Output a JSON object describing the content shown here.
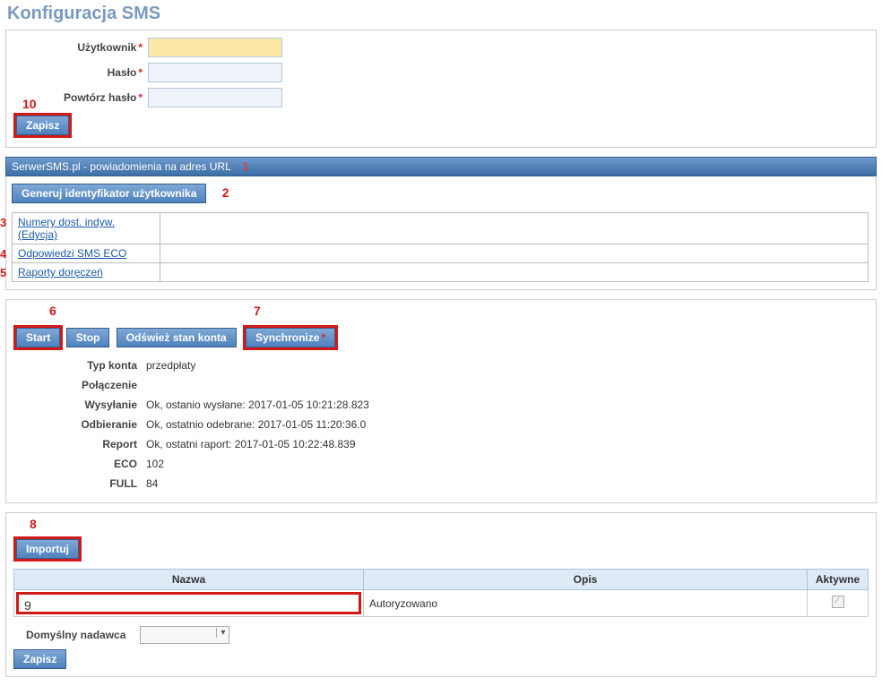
{
  "page": {
    "title": "Konfiguracja SMS"
  },
  "annotations": {
    "n1": "1",
    "n2": "2",
    "n3": "3",
    "n4": "4",
    "n5": "5",
    "n6": "6",
    "n7": "7",
    "n8": "8",
    "n9": "9",
    "n10": "10"
  },
  "credentials": {
    "user_label": "Użytkownik",
    "password_label": "Hasło",
    "password_repeat_label": "Powtórz hasło",
    "save_label": "Zapisz"
  },
  "url_section": {
    "header": "SerwerSMS.pl - powiadomienia na adres URL",
    "generate_button": "Generuj identyfikator użytkownika",
    "links": [
      "Numery dost. indyw. (Edycja)",
      "Odpowiedzi SMS ECO",
      "Raporty doręczeń"
    ]
  },
  "control": {
    "start": "Start",
    "stop": "Stop",
    "refresh": "Odśwież stan konta",
    "synchronize": "Synchronize",
    "rows": {
      "account_type_label": "Typ konta",
      "account_type_value": "przedpłaty",
      "connection_label": "Połączenie",
      "connection_value": "",
      "sending_label": "Wysyłanie",
      "sending_value": "Ok, ostanio wysłane: 2017-01-05 10:21:28.823",
      "receiving_label": "Odbieranie",
      "receiving_value": "Ok, ostatnio odebrane: 2017-01-05 11:20:36.0",
      "report_label": "Report",
      "report_value": "Ok, ostatni raport: 2017-01-05 10:22:48.839",
      "eco_label": "ECO",
      "eco_value": "102",
      "full_label": "FULL",
      "full_value": "84"
    }
  },
  "import_section": {
    "import_button": "Importuj",
    "cols": {
      "name": "Nazwa",
      "desc": "Opis",
      "active": "Aktywne"
    },
    "row": {
      "name": "",
      "desc": "Autoryzowano"
    },
    "default_sender_label": "Domyślny nadawca",
    "save_label": "Zapisz"
  }
}
